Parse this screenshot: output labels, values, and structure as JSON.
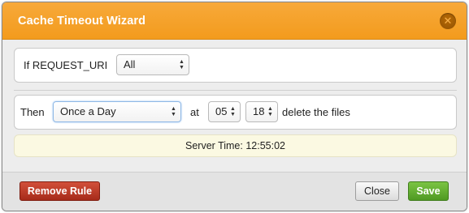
{
  "dialog": {
    "title": "Cache Timeout Wizard",
    "close_glyph": "✕"
  },
  "condition": {
    "if_label": "If REQUEST_URI",
    "uri_select": {
      "selected": "All"
    }
  },
  "schedule": {
    "then_label": "Then",
    "frequency_select": {
      "selected": "Once a Day"
    },
    "at_label": "at",
    "hour_select": {
      "selected": "05"
    },
    "minute_select": {
      "selected": "18"
    },
    "action_label": "delete the files"
  },
  "server_time": {
    "label": "Server Time:",
    "value": "12:55:02",
    "text": "Server Time: 12:55:02"
  },
  "buttons": {
    "remove_rule": "Remove Rule",
    "close": "Close",
    "save": "Save"
  },
  "colors": {
    "titlebar_orange": "#f39b1d",
    "remove_red": "#b93a27",
    "save_green": "#5aa82d",
    "server_time_bg": "#fbf9e2"
  },
  "icons": {
    "close": "close-icon",
    "select_arrows": "updown-arrows-icon"
  }
}
